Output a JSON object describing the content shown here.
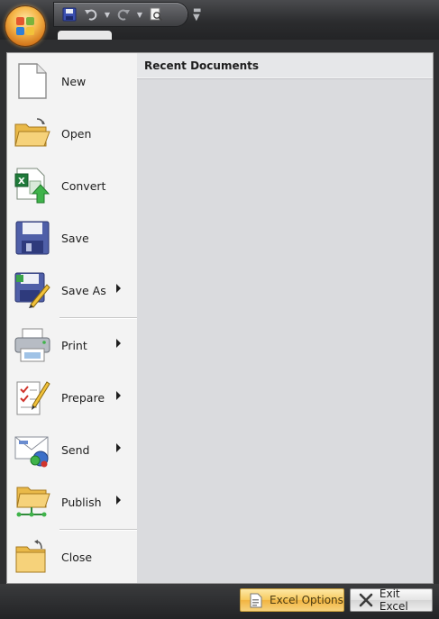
{
  "quick_access": {
    "save_icon": "save-icon",
    "undo_icon": "undo-icon",
    "redo_icon": "redo-icon",
    "print_preview_icon": "print-preview-icon",
    "customize_icon": "customize-toolbar-icon"
  },
  "menu": {
    "items": [
      {
        "label": "New",
        "icon": "new-document-icon",
        "submenu": false
      },
      {
        "label": "Open",
        "icon": "open-folder-icon",
        "submenu": false
      },
      {
        "label": "Convert",
        "icon": "convert-icon",
        "submenu": false
      },
      {
        "label": "Save",
        "icon": "save-disk-icon",
        "submenu": false
      },
      {
        "label": "Save As",
        "icon": "save-as-icon",
        "submenu": true
      },
      {
        "label": "Print",
        "icon": "printer-icon",
        "submenu": true
      },
      {
        "label": "Prepare",
        "icon": "prepare-checklist-icon",
        "submenu": true
      },
      {
        "label": "Send",
        "icon": "send-icon",
        "submenu": true
      },
      {
        "label": "Publish",
        "icon": "publish-folder-icon",
        "submenu": true
      },
      {
        "label": "Close",
        "icon": "close-folder-icon",
        "submenu": false
      }
    ]
  },
  "recent": {
    "header": "Recent Documents"
  },
  "footer": {
    "options_label": "Excel Options",
    "exit_label": "Exit Excel"
  },
  "colors": {
    "orb": "#f5b74a",
    "options_button": "#f7c95c",
    "recent_pane": "#dadbde"
  }
}
